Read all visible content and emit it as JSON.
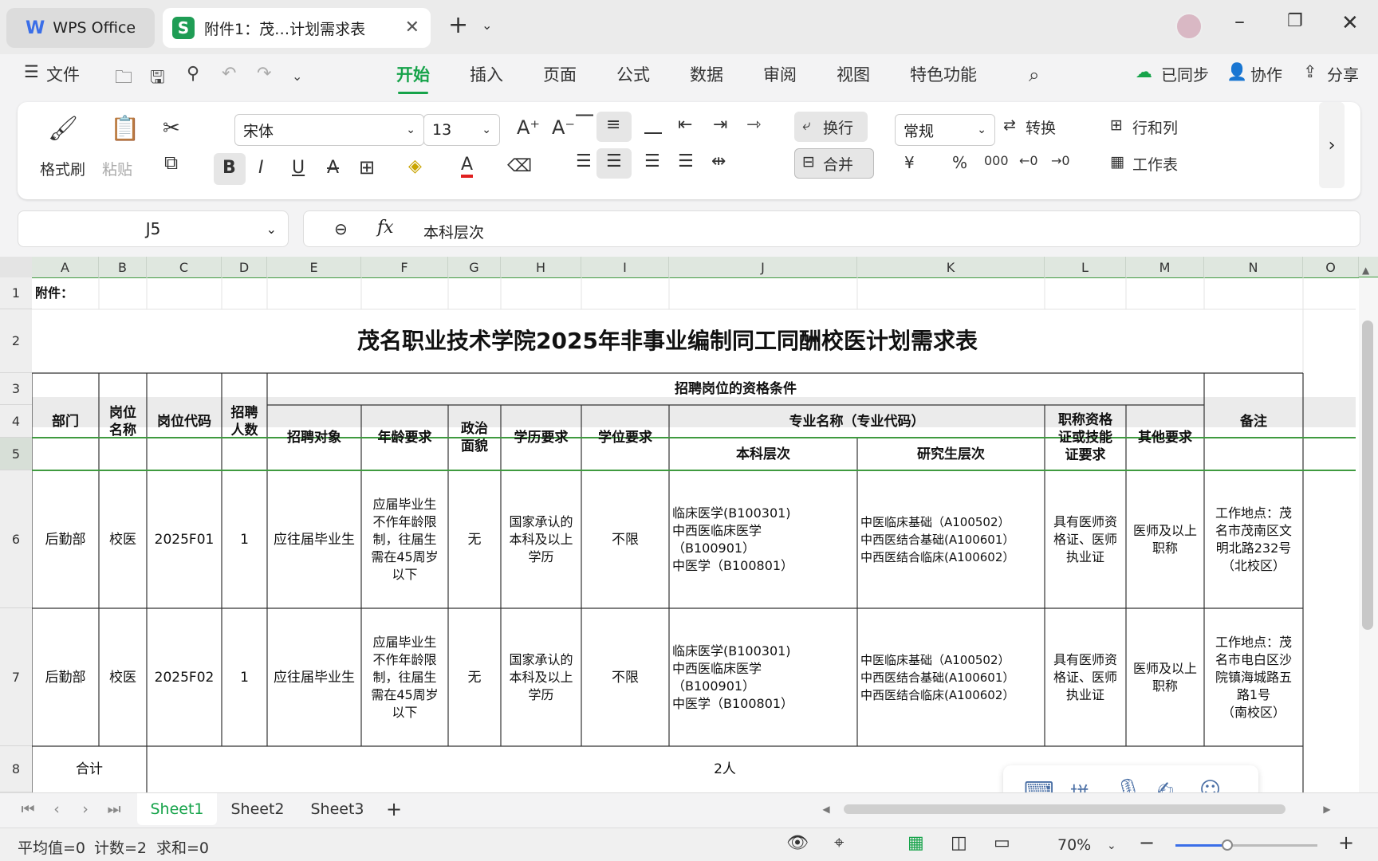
{
  "titlebar": {
    "app_tab": "WPS Office",
    "doc_tab": "附件1：茂…计划需求表"
  },
  "menu": {
    "file": "文件",
    "tabs": [
      "开始",
      "插入",
      "页面",
      "公式",
      "数据",
      "审阅",
      "视图",
      "特色功能"
    ],
    "active": "开始",
    "sync": "已同步",
    "collab": "协作",
    "share": "分享"
  },
  "ribbon": {
    "format_painter": "格式刷",
    "paste": "粘贴",
    "font_name": "宋体",
    "font_size": "13",
    "wrap": "换行",
    "merge": "合并",
    "number_format": "常规",
    "convert": "转换",
    "rows_cols": "行和列",
    "worksheet": "工作表"
  },
  "formula_bar": {
    "cell_ref": "J5",
    "value": "本科层次"
  },
  "columns": [
    "A",
    "B",
    "C",
    "D",
    "E",
    "F",
    "G",
    "H",
    "I",
    "J",
    "K",
    "L",
    "M",
    "N",
    "O"
  ],
  "rows": [
    "1",
    "2",
    "3",
    "4",
    "5",
    "6",
    "7",
    "8"
  ],
  "sheet": {
    "a1": "附件：",
    "title": "茂名职业技术学院2025年非事业编制同工同酬校医计划需求表",
    "headers": {
      "dept": "部门",
      "post_name": "岗位\n名称",
      "post_code": "岗位代码",
      "count": "招聘\n人数",
      "qualifications": "招聘岗位的资格条件",
      "target": "招聘对象",
      "age": "年龄要求",
      "political": "政治\n面貌",
      "education": "学历要求",
      "degree": "学位要求",
      "major": "专业名称（专业代码）",
      "undergrad": "本科层次",
      "graduate": "研究生层次",
      "cert": "职称资格\n证或技能\n证要求",
      "other": "其他要求",
      "remarks": "备注"
    },
    "data_rows": [
      {
        "dept": "后勤部",
        "post": "校医",
        "code": "2025F01",
        "count": "1",
        "target": "应往届毕业生",
        "age": "应届毕业生\n不作年龄限\n制，往届生\n需在45周岁\n以下",
        "political": "无",
        "education": "国家承认的\n本科及以上\n学历",
        "degree": "不限",
        "undergrad": "临床医学(B100301)\n中西医临床医学\n（B100901）\n中医学（B100801）",
        "graduate": "中医临床基础（A100502）\n中西医结合基础(A100601）\n中西医结合临床(A100602）",
        "cert": "具有医师资\n格证、医师\n执业证",
        "other": "医师及以上\n职称",
        "remarks": "工作地点：茂\n名市茂南区文\n明北路232号\n（北校区）"
      },
      {
        "dept": "后勤部",
        "post": "校医",
        "code": "2025F02",
        "count": "1",
        "target": "应往届毕业生",
        "age": "应届毕业生\n不作年龄限\n制，往届生\n需在45周岁\n以下",
        "political": "无",
        "education": "国家承认的\n本科及以上\n学历",
        "degree": "不限",
        "undergrad": "临床医学(B100301)\n中西医临床医学\n（B100901）\n中医学（B100801）",
        "graduate": "中医临床基础（A100502）\n中西医结合基础(A100601）\n中西医结合临床(A100602）",
        "cert": "具有医师资\n格证、医师\n执业证",
        "other": "医师及以上\n职称",
        "remarks": "工作地点：茂\n名市电白区沙\n院镇海城路五\n路1号\n（南校区）"
      }
    ],
    "total_label": "合计",
    "total_value": "2人"
  },
  "sheet_tabs": [
    "Sheet1",
    "Sheet2",
    "Sheet3"
  ],
  "active_sheet": "Sheet1",
  "status": {
    "average": "平均值=0",
    "count": "计数=2",
    "sum": "求和=0",
    "zoom": "70%"
  },
  "ime": {
    "pinyin": "拼"
  },
  "colors": {
    "accent": "#16a34a",
    "selection_border": "#3f9a3f"
  }
}
